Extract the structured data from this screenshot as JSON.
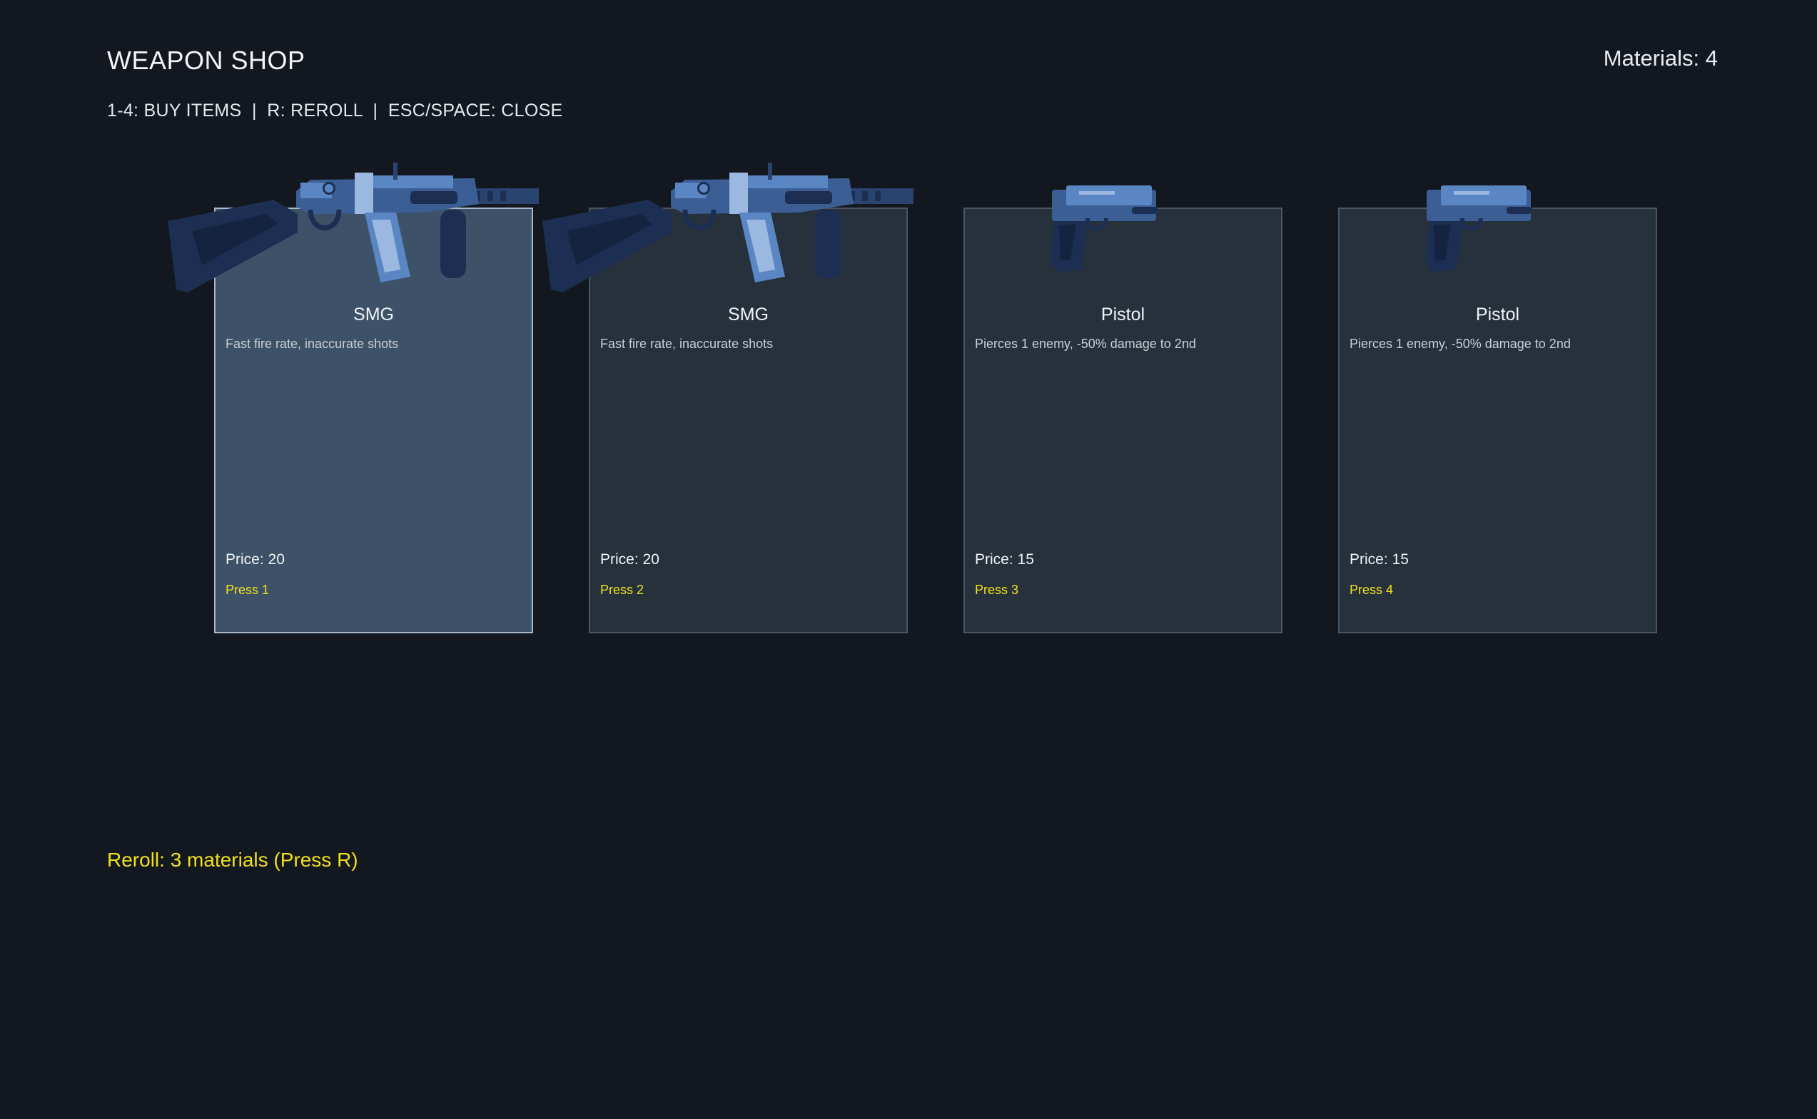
{
  "header": {
    "title": "WEAPON SHOP",
    "controls": "1-4: BUY ITEMS  |  R: REROLL  |  ESC/SPACE: CLOSE",
    "materials": "Materials: 4"
  },
  "items": [
    {
      "name": "SMG",
      "desc": "Fast fire rate, inaccurate shots",
      "price": "Price: 20",
      "key": "Press 1",
      "icon": "smg-icon",
      "selected": true
    },
    {
      "name": "SMG",
      "desc": "Fast fire rate, inaccurate shots",
      "price": "Price: 20",
      "key": "Press 2",
      "icon": "smg-icon",
      "selected": false
    },
    {
      "name": "Pistol",
      "desc": "Pierces 1 enemy, -50% damage to 2nd",
      "price": "Price: 15",
      "key": "Press 3",
      "icon": "pistol-icon",
      "selected": false
    },
    {
      "name": "Pistol",
      "desc": "Pierces 1 enemy, -50% damage to 2nd",
      "price": "Price: 15",
      "key": "Press 4",
      "icon": "pistol-icon",
      "selected": false
    }
  ],
  "reroll": "Reroll: 3 materials (Press R)",
  "colors": {
    "background": "#13171f",
    "card": "#27313c",
    "card_selected": "#3d5268",
    "accent_yellow": "#f0e11a",
    "weapon_light": "#5b86c4",
    "weapon_dark": "#1c2f52"
  }
}
